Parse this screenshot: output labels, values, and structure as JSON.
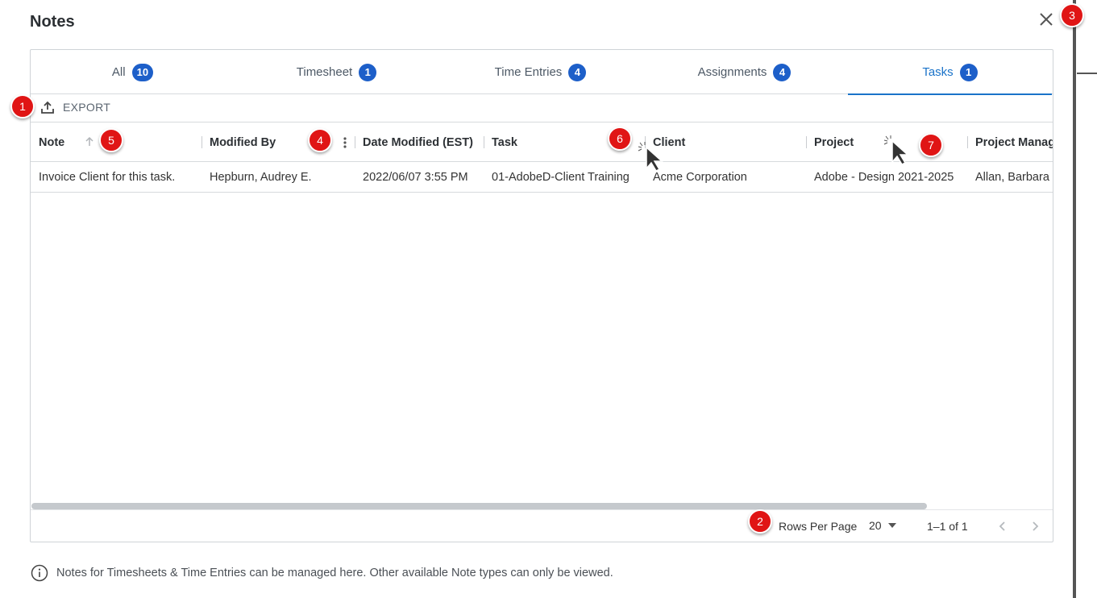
{
  "dialog": {
    "title": "Notes"
  },
  "tabs": [
    {
      "label": "All",
      "count": "10"
    },
    {
      "label": "Timesheet",
      "count": "1"
    },
    {
      "label": "Time Entries",
      "count": "4"
    },
    {
      "label": "Assignments",
      "count": "4"
    },
    {
      "label": "Tasks",
      "count": "1",
      "active": true
    }
  ],
  "toolbar": {
    "export_label": "EXPORT"
  },
  "table": {
    "columns": [
      "Note",
      "Modified By",
      "Date Modified (EST)",
      "Task",
      "Client",
      "Project",
      "Project Manag"
    ],
    "rows": [
      [
        "Invoice Client for this task.",
        "Hepburn, Audrey E.",
        "2022/06/07 3:55 PM",
        "01-AdobeD-Client Training",
        "Acme Corporation",
        "Adobe - Design 2021-2025",
        "Allan, Barbara"
      ]
    ]
  },
  "pagination": {
    "rows_per_page_label": "Rows Per Page",
    "rows_per_page_value": "20",
    "range": "1–1 of 1"
  },
  "info_text": "Notes for Timesheets & Time Entries can be managed here. Other available Note types can only be viewed.",
  "markers": [
    "1",
    "2",
    "3",
    "4",
    "5",
    "6",
    "7"
  ],
  "colors": {
    "accent": "#1a73c9",
    "badge": "#1d5fc9",
    "marker": "#e01515"
  }
}
